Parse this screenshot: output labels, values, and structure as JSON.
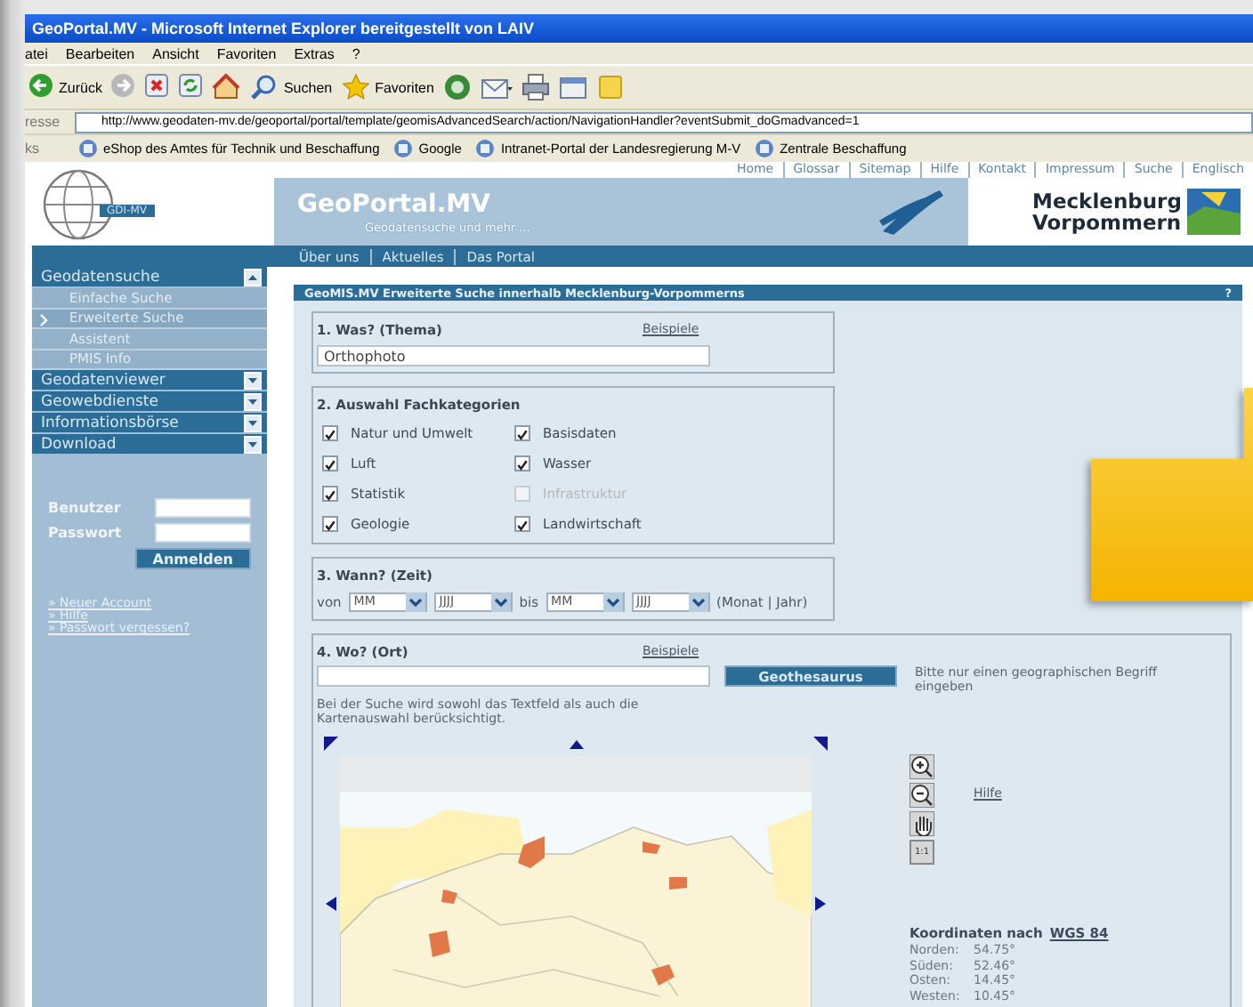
{
  "window": {
    "title": "GeoPortal.MV - Microsoft Internet Explorer bereitgestellt von LAIV"
  },
  "menu_bar": [
    "atei",
    "Bearbeiten",
    "Ansicht",
    "Favoriten",
    "Extras",
    "?"
  ],
  "toolbar": [
    {
      "kind": "back",
      "label": "Zurück"
    },
    {
      "kind": "forward"
    },
    {
      "kind": "stop"
    },
    {
      "kind": "refresh"
    },
    {
      "kind": "home"
    },
    {
      "kind": "search",
      "label": "Suchen"
    },
    {
      "kind": "favorites",
      "label": "Favoriten"
    },
    {
      "kind": "media"
    },
    {
      "kind": "mail"
    },
    {
      "kind": "print"
    },
    {
      "kind": "edit"
    },
    {
      "kind": "note"
    }
  ],
  "address_bar": {
    "label": "resse",
    "url": "http://www.geodaten-mv.de/geoportal/portal/template/geomisAdvancedSearch/action/NavigationHandler?eventSubmit_doGmadvanced=1"
  },
  "links_bar": {
    "label": "ks",
    "items": [
      "eShop des Amtes für Technik und Beschaffung",
      "Google",
      "Intranet-Portal der Landesregierung M-V",
      "Zentrale Beschaffung"
    ]
  },
  "top_links": [
    "Home",
    "Glossar",
    "Sitemap",
    "Hilfe",
    "Kontakt",
    "Impressum",
    "Suche",
    "Englisch"
  ],
  "logo": {
    "badge": "GDI-MV"
  },
  "banner": {
    "title": "GeoPortal.MV",
    "subtitle": "Geodatensuche und mehr ..."
  },
  "state_logo": {
    "lines": [
      "Mecklenburg",
      "Vorpommern"
    ]
  },
  "nav_links": [
    "Über uns",
    "Aktuelles",
    "Das Portal"
  ],
  "sidebar": {
    "items": [
      {
        "label": "Geodatensuche",
        "expanded": true,
        "children": [
          {
            "label": "Einfache Suche",
            "selected": false
          },
          {
            "label": "Erweiterte Suche",
            "selected": true
          },
          {
            "label": "Assistent",
            "selected": false
          },
          {
            "label": "PMIS Info",
            "selected": false
          }
        ]
      },
      {
        "label": "Geodatenviewer",
        "expanded": false
      },
      {
        "label": "Geowebdienste",
        "expanded": false
      },
      {
        "label": "Informationsbörse",
        "expanded": false
      },
      {
        "label": "Download",
        "expanded": false
      }
    ],
    "login": {
      "fields": [
        {
          "label": "Benutzer"
        },
        {
          "label": "Passwort"
        }
      ],
      "button": "Anmelden"
    },
    "links": [
      "» Neuer Account",
      "» Hilfe",
      "» Passwort vergessen?"
    ]
  },
  "search_panel": {
    "title": "GeoMIS.MV Erweiterte Suche innerhalb Mecklenburg-Vorpommerns",
    "help": "?",
    "sections": [
      {
        "kind": "theme",
        "heading": "1. Was? (Thema)",
        "link": "Beispiele",
        "value": "Orthophoto"
      },
      {
        "kind": "categories",
        "heading": "2. Auswahl Fachkategorien",
        "items": [
          {
            "label": "Natur und Umwelt",
            "checked": true,
            "disabled": false
          },
          {
            "label": "Basisdaten",
            "checked": true,
            "disabled": false
          },
          {
            "label": "Luft",
            "checked": true,
            "disabled": false
          },
          {
            "label": "Wasser",
            "checked": true,
            "disabled": false
          },
          {
            "label": "Statistik",
            "checked": true,
            "disabled": false
          },
          {
            "label": "Infrastruktur",
            "checked": false,
            "disabled": true
          },
          {
            "label": "Geologie",
            "checked": true,
            "disabled": false
          },
          {
            "label": "Landwirtschaft",
            "checked": true,
            "disabled": false
          }
        ]
      },
      {
        "kind": "time",
        "heading": "3. Wann? (Zeit)",
        "from_label": "von",
        "from": [
          "MM",
          "JJJJ"
        ],
        "to_label": "bis",
        "to": [
          "MM",
          "JJJJ"
        ],
        "hint": "(Monat | Jahr)"
      },
      {
        "kind": "place",
        "heading": "4. Wo? (Ort)",
        "link": "Beispiele",
        "button": "Geothesaurus",
        "hint": "Bitte nur einen geographischen Begriff eingeben",
        "note": "Bei der Suche wird sowohl das Textfeld als auch die Kartenauswahl berücksichtigt.",
        "map": {
          "kind": "picture"
        },
        "tools": [
          {
            "kind": "zoom_in"
          },
          {
            "kind": "zoom_out"
          },
          {
            "kind": "pan"
          },
          {
            "kind": "reset",
            "label": "1:1"
          }
        ],
        "help_link": "Hilfe",
        "coordinates": {
          "title": "Koordinaten nach",
          "system": "WGS 84",
          "values": [
            {
              "label": "Norden:",
              "value": "54.75°"
            },
            {
              "label": "Süden:",
              "value": "52.46°"
            },
            {
              "label": "Osten:",
              "value": "14.45°"
            },
            {
              "label": "Westen:",
              "value": "10.45°"
            }
          ]
        }
      }
    ]
  },
  "overlay": {
    "kind": "callout"
  }
}
